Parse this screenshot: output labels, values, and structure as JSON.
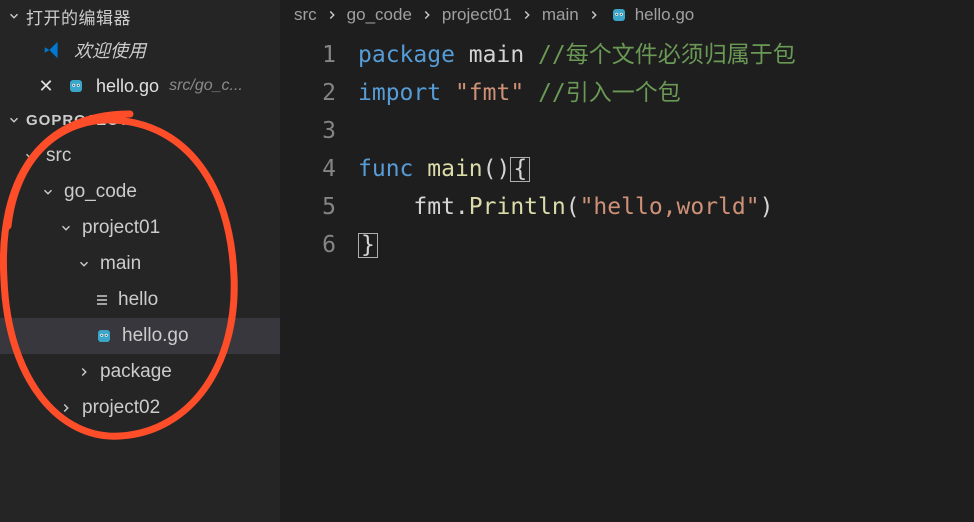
{
  "sidebar": {
    "open_editors_label": "打开的编辑器",
    "welcome_label": "欢迎使用",
    "open_tab": {
      "name": "hello.go",
      "path": "src/go_c..."
    },
    "project_label": "GOPROJECT",
    "tree": [
      {
        "label": "src",
        "expanded": true,
        "indent": 0,
        "type": "folder"
      },
      {
        "label": "go_code",
        "expanded": true,
        "indent": 1,
        "type": "folder"
      },
      {
        "label": "project01",
        "expanded": true,
        "indent": 2,
        "type": "folder"
      },
      {
        "label": "main",
        "expanded": true,
        "indent": 3,
        "type": "folder"
      },
      {
        "label": "hello",
        "indent": 4,
        "type": "file-text"
      },
      {
        "label": "hello.go",
        "indent": 4,
        "type": "file-go",
        "selected": true
      },
      {
        "label": "package",
        "expanded": false,
        "indent": 3,
        "type": "folder"
      },
      {
        "label": "project02",
        "expanded": false,
        "indent": 2,
        "type": "folder"
      }
    ]
  },
  "breadcrumbs": [
    {
      "label": "src"
    },
    {
      "label": "go_code"
    },
    {
      "label": "project01"
    },
    {
      "label": "main"
    },
    {
      "label": "hello.go",
      "icon": "gopher"
    }
  ],
  "code": {
    "lines": [
      {
        "n": 1,
        "segments": [
          {
            "t": "package",
            "c": "kw"
          },
          {
            "t": " ",
            "c": "ident"
          },
          {
            "t": "main",
            "c": "ident"
          },
          {
            "t": " ",
            "c": "ident"
          },
          {
            "t": "//每个文件必须归属于包",
            "c": "cmt"
          }
        ]
      },
      {
        "n": 2,
        "segments": [
          {
            "t": "import",
            "c": "kw"
          },
          {
            "t": " ",
            "c": "ident"
          },
          {
            "t": "\"fmt\"",
            "c": "str"
          },
          {
            "t": " ",
            "c": "ident"
          },
          {
            "t": "//引入一个包",
            "c": "cmt"
          }
        ]
      },
      {
        "n": 3,
        "segments": []
      },
      {
        "n": 4,
        "segments": [
          {
            "t": "func",
            "c": "kw"
          },
          {
            "t": " ",
            "c": "ident"
          },
          {
            "t": "main",
            "c": "func-name"
          },
          {
            "t": "()",
            "c": "punct"
          },
          {
            "t": "{",
            "c": "punct",
            "boxed": true
          }
        ]
      },
      {
        "n": 5,
        "segments": [
          {
            "t": "    fmt.",
            "c": "ident"
          },
          {
            "t": "Println",
            "c": "func-name"
          },
          {
            "t": "(",
            "c": "punct"
          },
          {
            "t": "\"hello,world\"",
            "c": "str"
          },
          {
            "t": ")",
            "c": "punct"
          }
        ]
      },
      {
        "n": 6,
        "segments": [
          {
            "t": "}",
            "c": "punct",
            "boxed": true
          }
        ]
      }
    ]
  },
  "colors": {
    "annotation": "#fe4d29"
  }
}
